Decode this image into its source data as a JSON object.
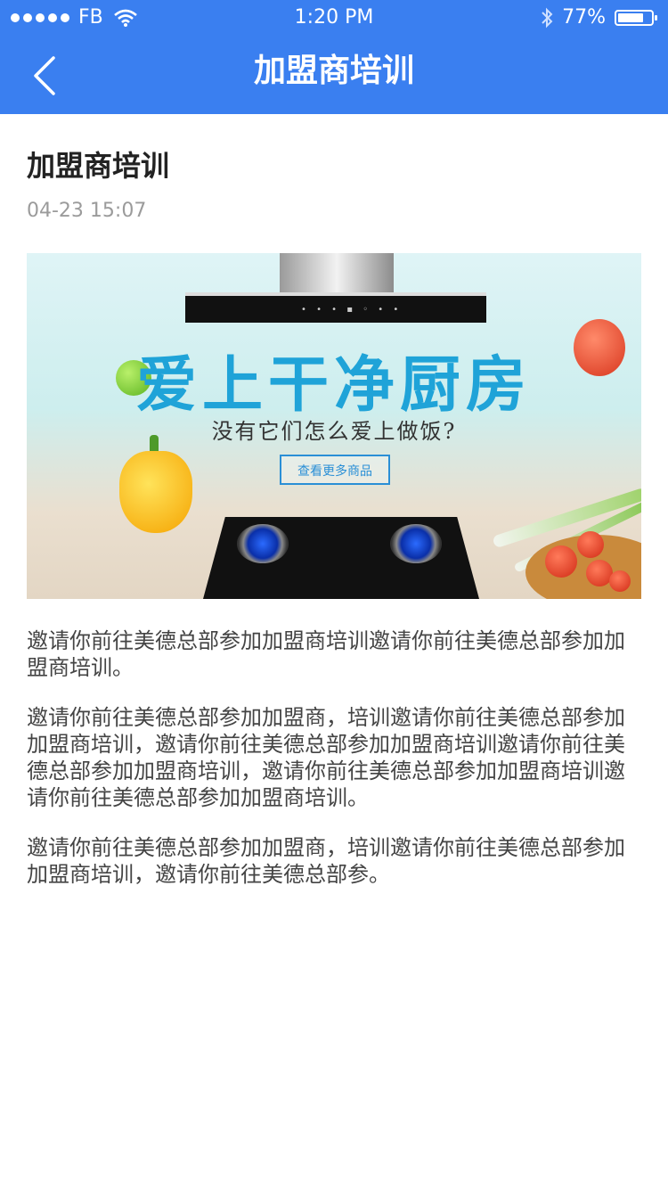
{
  "status_bar": {
    "carrier": "FB",
    "time": "1:20 PM",
    "battery_percent": "77%",
    "battery_level": 0.77,
    "icons": [
      "signal-dots",
      "wifi-icon",
      "bluetooth-icon",
      "battery-icon"
    ]
  },
  "nav": {
    "title": "加盟商培训",
    "back_icon": "chevron-left-icon"
  },
  "article": {
    "title": "加盟商培训",
    "date": "04-23 15:07",
    "banner": {
      "headline": "爱上干净厨房",
      "subline": "没有它们怎么爱上做饭?",
      "button_label": "查看更多商品"
    },
    "paragraphs": [
      "邀请你前往美德总部参加加盟商培训邀请你前往美德总部参加加盟商培训。",
      "邀请你前往美德总部参加加盟商，培训邀请你前往美德总部参加加盟商培训，邀请你前往美德总部参加加盟商培训邀请你前往美德总部参加加盟商培训，邀请你前往美德总部参加加盟商培训邀请你前往美德总部参加加盟商培训。",
      "邀请你前往美德总部参加加盟商，培训邀请你前往美德总部参加加盟商培训，邀请你前往美德总部参。"
    ]
  },
  "colors": {
    "header_bg": "#3a7ff0",
    "title_text": "#222222",
    "date_text": "#9b9b9b",
    "body_text": "#444444"
  }
}
